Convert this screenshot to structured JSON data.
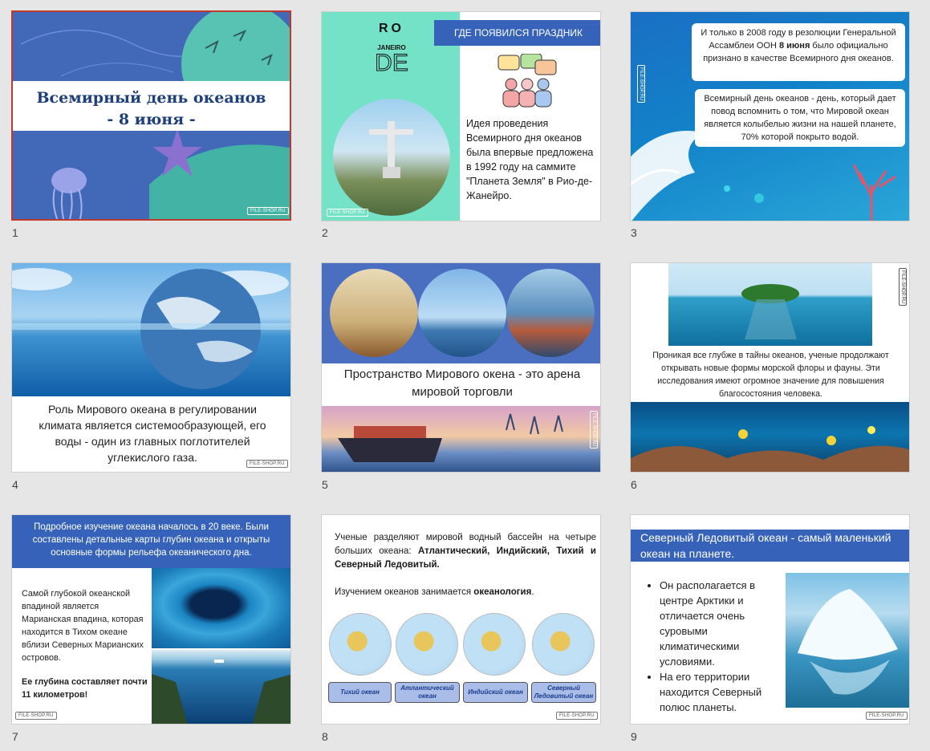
{
  "slides": [
    {
      "num": "1",
      "title": "Всемирный день океанов\n- 8 июня -",
      "watermark": "FILE-SHOP.RU"
    },
    {
      "num": "2",
      "header": "ГДЕ ПОЯВИЛСЯ ПРАЗДНИК",
      "logo": {
        "top": "RO",
        "mid": "JANEIRO",
        "bottom": "DE"
      },
      "text": "Идея проведения Всемирного дня океанов была впервые предложена в 1992 году на саммите  \"Планета Земля\" в Рио-де-Жанейро.",
      "watermark": "FILE-SHOP.RU"
    },
    {
      "num": "3",
      "box1_pre": "И только в 2008 году в резолюции Генеральной Ассамблеи ООН ",
      "box1_bold": "8 июня",
      "box1_post": " было официально признано в качестве Всемирного дня океанов.",
      "box2": "Всемирный день океанов - день, который дает повод вспомнить о том, что Мировой океан является колыбелью жизни на нашей планете, 70% которой покрыто водой.",
      "watermark": "FILE-SHOP.RU"
    },
    {
      "num": "4",
      "text": "Роль Мирового океана в регулировании климата является системообразующей, его воды - один из главных поглотителей углекислого газа.",
      "watermark": "FILE-SHOP.RU"
    },
    {
      "num": "5",
      "text": "Пространство Мирового окена - это арена мировой торговли",
      "watermark": "FILE-SHOP.RU"
    },
    {
      "num": "6",
      "text": "Проникая все глубже в тайны океанов, ученые продолжают открывать новые формы морской флоры и фауны. Эти исследования имеют огромное значение для повышения благосостояния человека.",
      "watermark": "FILE-SHOP.RU"
    },
    {
      "num": "7",
      "header": "Подробное изучение океана началось в 20 веке. Были составлены детальные карты глубин океана и открыты основные формы рельефа океанического дна.",
      "text": "Самой глубокой океанской впадиной является Марианская впадина, которая находится в Тихом океане вблизи Северных Марианских островов.",
      "bold": "Ее глубина составляет почти 11 километров!",
      "watermark": "FILE-SHOP.RU"
    },
    {
      "num": "8",
      "p1_pre": "Ученые разделяют мировой водный бассейн на четыре больших океана: ",
      "p1_bold": "Атлантический, Индийский, Тихий и Северный Ледовитый.",
      "p2_pre": "Изучением океанов занимается ",
      "p2_bold": "океанология",
      "p2_post": ".",
      "buttons": [
        "Тихий океан",
        "Атлантический океан",
        "Индийский океан",
        "Северный Ледовитый океан"
      ],
      "watermark": "FILE-SHOP.RU"
    },
    {
      "num": "9",
      "header": "Северный Ледовитый океан - самый маленький океан на планете.",
      "bullets": [
        "Он располагается в центре Арктики и отличается очень суровыми климатическими условиями.",
        "На его территории находится Северный полюс планеты."
      ],
      "watermark": "FILE-SHOP.RU"
    }
  ],
  "colors": {
    "selection": "#c0392b",
    "accent": "#3663b9"
  }
}
